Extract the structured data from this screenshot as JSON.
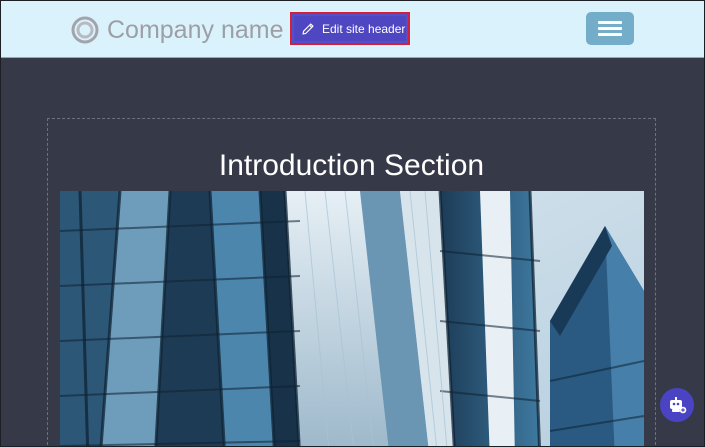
{
  "header": {
    "logo_icon": "ring-logo-icon",
    "company_name": "Company name",
    "edit_button_label": "Edit site header",
    "edit_icon": "pencil-icon",
    "menu_icon": "hamburger-menu-icon"
  },
  "main": {
    "section_title": "Introduction Section",
    "hero_image": "building-facade-image"
  },
  "fab": {
    "icon": "bot-add-icon"
  },
  "colors": {
    "header_bg": "#d9f2fc",
    "page_bg": "#363a48",
    "accent": "#4f47c2",
    "highlight_border": "#d3203a",
    "menu_button": "#74adc9"
  }
}
